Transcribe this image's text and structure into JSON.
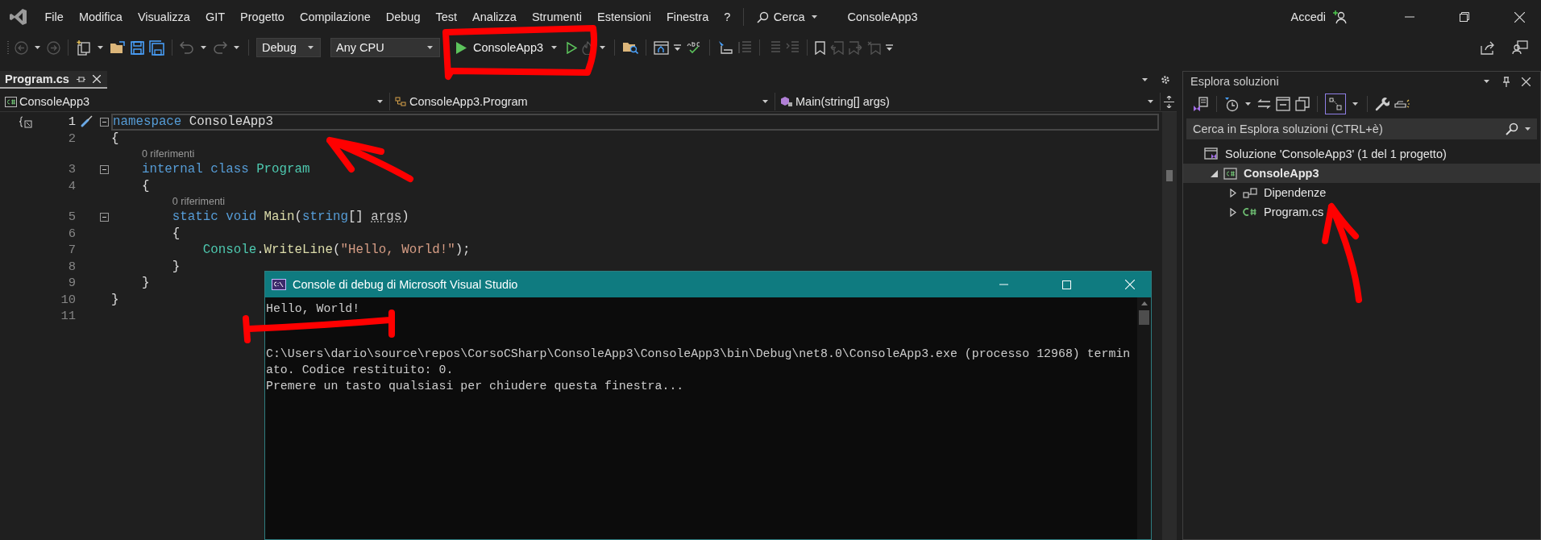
{
  "menu_bar": {
    "items": [
      "File",
      "Modifica",
      "Visualizza",
      "GIT",
      "Progetto",
      "Compilazione",
      "Debug",
      "Test",
      "Analizza",
      "Strumenti",
      "Estensioni",
      "Finestra",
      "?"
    ],
    "search": "Cerca",
    "solution_name": "ConsoleApp3",
    "sign_in": "Accedi"
  },
  "toolbar": {
    "configuration": "Debug",
    "platform": "Any CPU",
    "start_target": "ConsoleApp3"
  },
  "editor": {
    "tabs": [
      {
        "label": "Program.cs",
        "selected": true
      }
    ],
    "navigation": [
      "ConsoleApp3",
      "ConsoleApp3.Program",
      "Main(string[] args)"
    ],
    "lines": [
      {
        "number": "1",
        "current": true,
        "foldable": true,
        "tokens": [
          {
            "kind": "keyword",
            "text": "namespace "
          },
          {
            "kind": "plain",
            "text": "ConsoleApp3"
          }
        ]
      },
      {
        "number": "2",
        "current": false,
        "foldable": false,
        "tokens": [
          {
            "kind": "plain",
            "text": "{"
          }
        ]
      },
      {
        "number": "3",
        "current": false,
        "foldable": true,
        "codelens": "0 riferimenti",
        "tokens": [
          {
            "kind": "keyword",
            "text": "    internal class "
          },
          {
            "kind": "type",
            "text": "Program"
          }
        ]
      },
      {
        "number": "4",
        "current": false,
        "foldable": false,
        "tokens": [
          {
            "kind": "plain",
            "text": "    {"
          }
        ]
      },
      {
        "number": "5",
        "current": false,
        "foldable": true,
        "codelens": "0 riferimenti",
        "tokens": [
          {
            "kind": "keyword",
            "text": "        static void "
          },
          {
            "kind": "method",
            "text": "Main"
          },
          {
            "kind": "plain",
            "text": "("
          },
          {
            "kind": "keyword",
            "text": "string"
          },
          {
            "kind": "plain",
            "text": "[] "
          },
          {
            "kind": "parameter",
            "text": "args"
          },
          {
            "kind": "plain",
            "text": ")"
          }
        ]
      },
      {
        "number": "6",
        "current": false,
        "foldable": false,
        "tokens": [
          {
            "kind": "plain",
            "text": "        {"
          }
        ]
      },
      {
        "number": "7",
        "current": false,
        "foldable": false,
        "tokens": [
          {
            "kind": "type",
            "text": "            Console"
          },
          {
            "kind": "plain",
            "text": "."
          },
          {
            "kind": "method",
            "text": "WriteLine"
          },
          {
            "kind": "plain",
            "text": "("
          },
          {
            "kind": "string",
            "text": "\"Hello, World!\""
          },
          {
            "kind": "plain",
            "text": ");"
          }
        ]
      },
      {
        "number": "8",
        "current": false,
        "foldable": false,
        "tokens": [
          {
            "kind": "plain",
            "text": "        }"
          }
        ]
      },
      {
        "number": "9",
        "current": false,
        "foldable": false,
        "tokens": [
          {
            "kind": "plain",
            "text": "    }"
          }
        ]
      },
      {
        "number": "10",
        "current": false,
        "foldable": false,
        "tokens": [
          {
            "kind": "plain",
            "text": "}"
          }
        ]
      },
      {
        "number": "11",
        "current": false,
        "foldable": false
      }
    ]
  },
  "console_window": {
    "title": "Console di debug di Microsoft Visual Studio",
    "program_output": [
      "Hello, World!"
    ],
    "exit_message": [
      "C:\\Users\\dario\\source\\repos\\CorsoCSharp\\ConsoleApp3\\ConsoleApp3\\bin\\Debug\\net8.0\\ConsoleApp3.exe (processo 12968) termin",
      "ato. Codice restituito: 0.",
      "Premere un tasto qualsiasi per chiudere questa finestra..."
    ]
  },
  "solution_explorer": {
    "title": "Esplora soluzioni",
    "search": {
      "placeholder": "Cerca in Esplora soluzioni (CTRL+è)"
    },
    "tree": [
      {
        "kind": "solution",
        "label": "Soluzione 'ConsoleApp3' (1 del 1 progetto)",
        "selected": false,
        "children": [
          {
            "kind": "project",
            "label": "ConsoleApp3",
            "selected": true,
            "expanded": true,
            "children": [
              {
                "kind": "dependencies",
                "label": "Dipendenze",
                "selected": false,
                "expanded": false
              },
              {
                "kind": "csharp-file",
                "label": "Program.cs",
                "selected": false,
                "expanded": false
              }
            ]
          }
        ]
      }
    ]
  }
}
